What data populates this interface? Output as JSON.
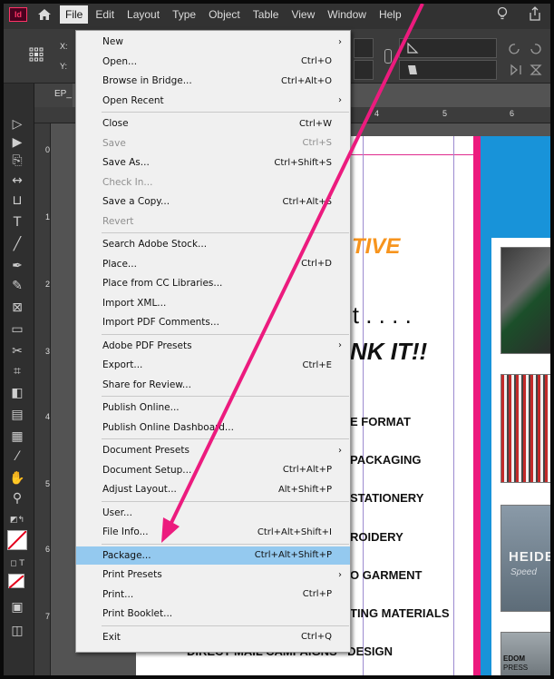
{
  "menubar": {
    "app_logo": "Id",
    "items": [
      "File",
      "Edit",
      "Layout",
      "Type",
      "Object",
      "Table",
      "View",
      "Window",
      "Help"
    ]
  },
  "control_panel": {
    "x_label": "X:",
    "y_label": "Y:"
  },
  "doc_tab": {
    "label": "EP_"
  },
  "ruler_h_numbers": [
    "4",
    "5",
    "6"
  ],
  "ruler_v_numbers": [
    "0",
    "1",
    "2",
    "3",
    "4",
    "5",
    "6",
    "7"
  ],
  "file_menu": {
    "items": [
      {
        "label": "New",
        "shortcut": "",
        "submenu": true,
        "disabled": false
      },
      {
        "label": "Open...",
        "shortcut": "Ctrl+O",
        "submenu": false,
        "disabled": false
      },
      {
        "label": "Browse in Bridge...",
        "shortcut": "Ctrl+Alt+O",
        "submenu": false,
        "disabled": false
      },
      {
        "label": "Open Recent",
        "shortcut": "",
        "submenu": true,
        "disabled": false
      },
      {
        "label": "Close",
        "shortcut": "Ctrl+W",
        "submenu": false,
        "disabled": false
      },
      {
        "label": "Save",
        "shortcut": "Ctrl+S",
        "submenu": false,
        "disabled": true
      },
      {
        "label": "Save As...",
        "shortcut": "Ctrl+Shift+S",
        "submenu": false,
        "disabled": false
      },
      {
        "label": "Check In...",
        "shortcut": "",
        "submenu": false,
        "disabled": true
      },
      {
        "label": "Save a Copy...",
        "shortcut": "Ctrl+Alt+S",
        "submenu": false,
        "disabled": false
      },
      {
        "label": "Revert",
        "shortcut": "",
        "submenu": false,
        "disabled": true
      },
      {
        "label": "Search Adobe Stock...",
        "shortcut": "",
        "submenu": false,
        "disabled": false
      },
      {
        "label": "Place...",
        "shortcut": "Ctrl+D",
        "submenu": false,
        "disabled": false
      },
      {
        "label": "Place from CC Libraries...",
        "shortcut": "",
        "submenu": false,
        "disabled": false
      },
      {
        "label": "Import XML...",
        "shortcut": "",
        "submenu": false,
        "disabled": false
      },
      {
        "label": "Import PDF Comments...",
        "shortcut": "",
        "submenu": false,
        "disabled": false
      },
      {
        "label": "Adobe PDF Presets",
        "shortcut": "",
        "submenu": true,
        "disabled": false
      },
      {
        "label": "Export...",
        "shortcut": "Ctrl+E",
        "submenu": false,
        "disabled": false
      },
      {
        "label": "Share for Review...",
        "shortcut": "",
        "submenu": false,
        "disabled": false
      },
      {
        "label": "Publish Online...",
        "shortcut": "",
        "submenu": false,
        "disabled": false
      },
      {
        "label": "Publish Online Dashboard...",
        "shortcut": "",
        "submenu": false,
        "disabled": false
      },
      {
        "label": "Document Presets",
        "shortcut": "",
        "submenu": true,
        "disabled": false
      },
      {
        "label": "Document Setup...",
        "shortcut": "Ctrl+Alt+P",
        "submenu": false,
        "disabled": false
      },
      {
        "label": "Adjust Layout...",
        "shortcut": "Alt+Shift+P",
        "submenu": false,
        "disabled": false
      },
      {
        "label": "User...",
        "shortcut": "",
        "submenu": false,
        "disabled": false
      },
      {
        "label": "File Info...",
        "shortcut": "Ctrl+Alt+Shift+I",
        "submenu": false,
        "disabled": false
      },
      {
        "label": "Package...",
        "shortcut": "Ctrl+Alt+Shift+P",
        "submenu": false,
        "disabled": false,
        "highlighted": true
      },
      {
        "label": "Print Presets",
        "shortcut": "",
        "submenu": true,
        "disabled": false
      },
      {
        "label": "Print...",
        "shortcut": "Ctrl+P",
        "submenu": false,
        "disabled": false
      },
      {
        "label": "Print Booklet...",
        "shortcut": "",
        "submenu": false,
        "disabled": false
      },
      {
        "label": "Exit",
        "shortcut": "Ctrl+Q",
        "submenu": false,
        "disabled": false
      }
    ]
  },
  "page_text": {
    "tive": "TIVE",
    "it_dots": "it . . . .",
    "nk_it": "NK IT!!",
    "format": "E FORMAT",
    "packaging": "PACKAGING",
    "stationery": "STATIONERY",
    "embroidery": "ROIDERY",
    "garment": "O GARMENT",
    "materials": "TING MATERIALS",
    "direct_mail": "DIRECT MAIL CAMPAIGNS · DESIGN",
    "heidel": "HEIDEL",
    "speed": "Speed",
    "edom": "EDOM",
    "press": "PRESS"
  },
  "colors": {
    "accent_pink": "#ec1b7e",
    "orange": "#f7941d",
    "blue_panel": "#1893d9",
    "highlight": "#94c9ef"
  }
}
